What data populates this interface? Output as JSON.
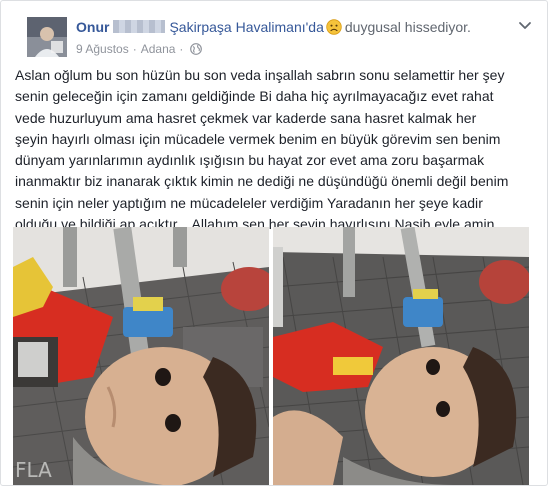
{
  "post": {
    "author_first": "Onur",
    "place_prefix": "Şakirpaşa Havalimanı'da",
    "feeling": "duygusal hissediyor.",
    "date": "9 Ağustos",
    "separator": "·",
    "city": "Adana",
    "separator2": "·",
    "body": "Aslan oğlum bu son hüzün bu son veda inşallah sabrın sonu selamettir her şey\nsenin geleceğin için zamanı geldiğinde Bi daha hiç ayrılmayacağız evet rahat\nvede huzurluyum ama hasret çekmek var kaderde sana hasret kalmak her\nşeyin hayırlı olması için mücadele vermek benim en büyük görevim sen benim\ndünyam yarınlarımın aydınlık ışığısın bu hayat zor evet ama zoru başarmak\ninanmaktır biz inanarak çıktık kimin ne dediği ne düşündüğü önemli değil benim\nsenin için neler yaptığım ne mücadeleler verdiğim Yaradanın her şeye kadir\nolduğu ve bildiği ap açıktır... Allahım sen her şeyin hayırlısını Nasib eyle amin..."
  },
  "icons": {
    "feeling": "sad-face-icon",
    "privacy": "globe-icon",
    "menu": "chevron-down-icon"
  },
  "colors": {
    "link": "#365899",
    "meta": "#90949c",
    "text": "#1d2129"
  }
}
